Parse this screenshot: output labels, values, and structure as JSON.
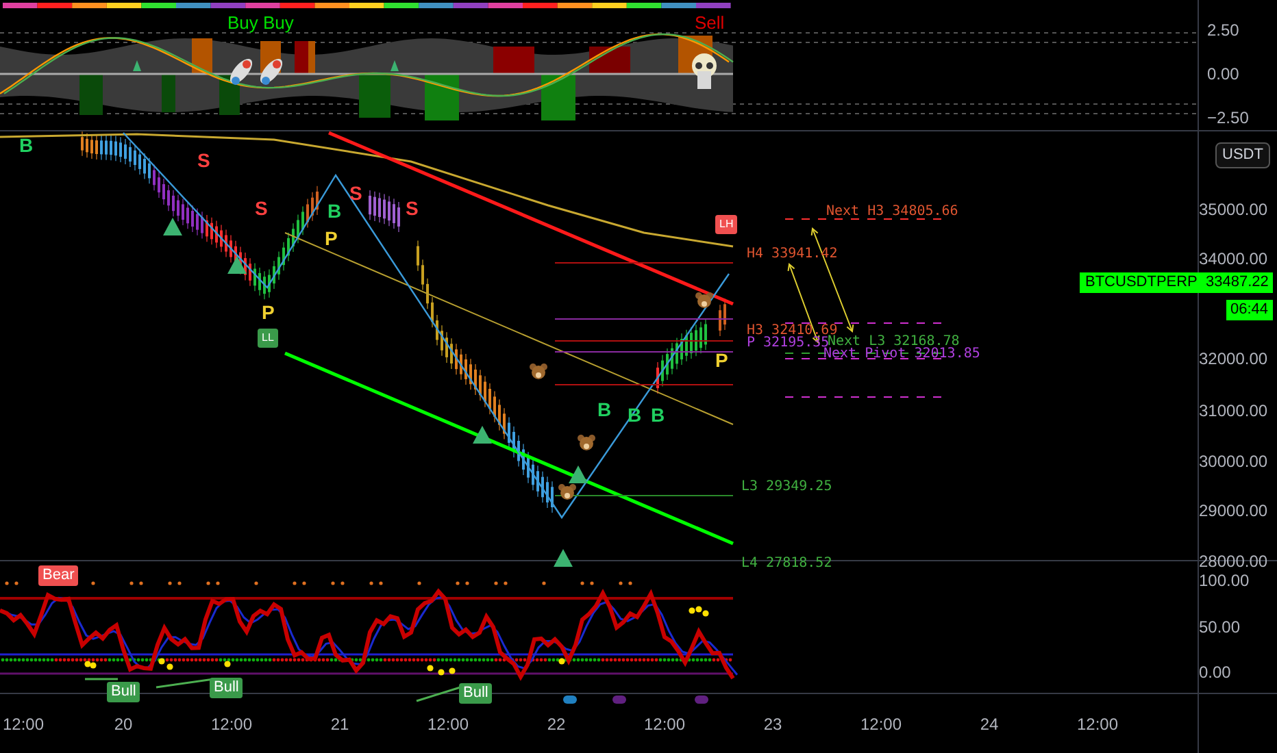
{
  "top_panel": {
    "labels": [
      {
        "text": "Buy Buy",
        "kind": "buy"
      },
      {
        "text": "Sell",
        "kind": "sell"
      }
    ],
    "axis": [
      "2.50",
      "0.00",
      "−2.50"
    ]
  },
  "main_panel": {
    "currency": "USDT",
    "axis": [
      "35000.00",
      "34000.00",
      "32000.00",
      "31000.00",
      "30000.00",
      "29000.00",
      "28000.00"
    ],
    "symbol": "BTCUSDTPERP",
    "price": "33487.22",
    "countdown": "06:44",
    "signals": [
      {
        "text": "B",
        "kind": "buy"
      },
      {
        "text": "S",
        "kind": "sell"
      },
      {
        "text": "S",
        "kind": "sell"
      },
      {
        "text": "B",
        "kind": "buy"
      },
      {
        "text": "S",
        "kind": "sell"
      },
      {
        "text": "S",
        "kind": "sell"
      },
      {
        "text": "P",
        "kind": "pivot"
      },
      {
        "text": "P",
        "kind": "pivot"
      },
      {
        "text": "B",
        "kind": "buy"
      },
      {
        "text": "B",
        "kind": "buy"
      },
      {
        "text": "B",
        "kind": "buy"
      },
      {
        "text": "P",
        "kind": "pivot"
      }
    ],
    "swing_tags": [
      {
        "text": "LL",
        "kind": "low"
      },
      {
        "text": "LH",
        "kind": "high"
      }
    ],
    "pivots": [
      {
        "text": "Next H3 34805.66",
        "kind": "resistance"
      },
      {
        "text": "H4 33941.42",
        "kind": "resistance"
      },
      {
        "text": "H3 32410.69",
        "kind": "resistance"
      },
      {
        "text": "P 32195.35",
        "kind": "pivot"
      },
      {
        "text": "Next L3 32168.78",
        "kind": "support"
      },
      {
        "text": "Next Pivot 32013.85",
        "kind": "pivot"
      },
      {
        "text": "L3 29349.25",
        "kind": "support"
      },
      {
        "text": "L4 27818.52",
        "kind": "support"
      }
    ]
  },
  "oscillator": {
    "labels": [
      {
        "text": "Bear",
        "kind": "bear"
      },
      {
        "text": "Bull",
        "kind": "bull"
      },
      {
        "text": "Bull",
        "kind": "bull"
      },
      {
        "text": "Bull",
        "kind": "bull"
      }
    ],
    "axis": [
      "100.00",
      "50.00",
      "0.00"
    ]
  },
  "time_axis": [
    "12:00",
    "20",
    "12:00",
    "21",
    "12:00",
    "22",
    "12:00",
    "23",
    "12:00",
    "24",
    "12:00"
  ]
}
